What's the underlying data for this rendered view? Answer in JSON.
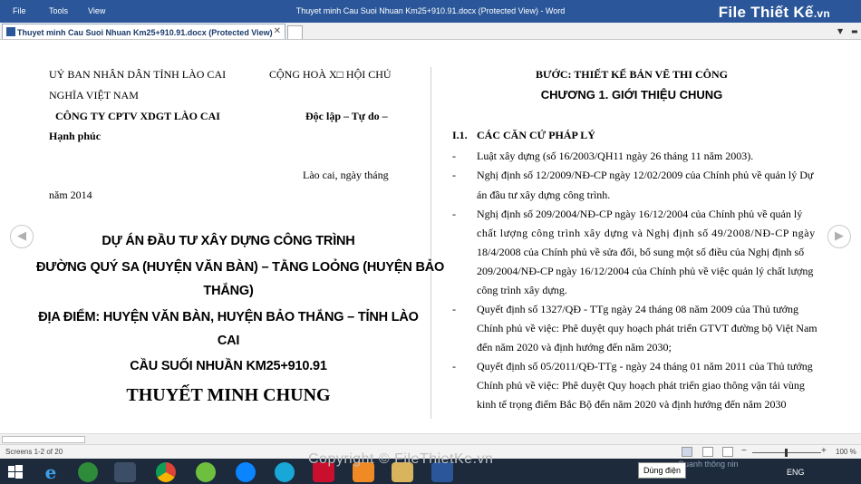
{
  "menu": {
    "file": "File",
    "tools": "Tools",
    "view": "View"
  },
  "window": {
    "title": "Thuyet minh Cau Suoi Nhuan Km25+910.91.docx (Protected View) - Word"
  },
  "brand": {
    "name": "File",
    "name2": "Thiết Kế",
    "suffix": ".vn"
  },
  "tab": {
    "label": "Thuyet minh Cau Suoi Nhuan Km25+910.91.docx (Protected View)",
    "close": "✕"
  },
  "left_page": {
    "gov": "UỶ BAN NHÂN DÂN TỈNH LÀO CAI",
    "republic": "CỘNG HOÀ X□ HỘI CHỦ",
    "vietnam": "NGHĨA VIỆT NAM",
    "company": "CÔNG TY CPTV XDGT LÀO CAI",
    "independence": "Độc lập – Tự do –",
    "happiness": "Hạnh phúc",
    "place_date": "Lào cai, ngày   tháng",
    "year": "năm 2014",
    "project_1": "DỰ ÁN ĐẦU TƯ XÂY DỰNG CÔNG TRÌNH",
    "project_2": "ĐƯỜNG QUÝ SA (HUYỆN VĂN BÀN) – TẰNG LOỎNG (HUYỆN BẢO",
    "project_3": "THẮNG)",
    "location_1": "ĐỊA ĐIỂM: HUYỆN VĂN BÀN, HUYỆN BẢO THẮNG – TỈNH LÀO",
    "location_2": "CAI",
    "bridge": "CẦU SUỐI NHUẦN KM25+910.91",
    "doc_title": "THUYẾT MINH CHUNG"
  },
  "right_page": {
    "step": "BƯỚC: THIẾT KẾ BẢN VẼ THI CÔNG",
    "chapter": "CHƯƠNG 1. GIỚI THIỆU CHUNG",
    "section_no": "I.1.",
    "section_title": "CÁC CĂN CỨ PHÁP LÝ",
    "bullet": "-",
    "lines": [
      "Luật xây dựng (số 16/2003/QH11 ngày 26 tháng 11 năm 2003).",
      "Nghị định số 12/2009/NĐ-CP ngày 12/02/2009 của Chính phủ về quản lý Dự",
      "án đầu tư xây dựng công trình.",
      "Nghị định số 209/2004/NĐ-CP ngày 16/12/2004 của Chính phủ về quản lý",
      "chất lượng công trình xây dựng và Nghị định số 49/2008/NĐ-CP ngày",
      "18/4/2008 của Chính phủ về sửa đổi, bổ sung một số điều của Nghị định số",
      "209/2004/NĐ-CP ngày 16/12/2004 của Chính phủ về việc quản lý chất lượng",
      "công trình xây dựng.",
      "Quyết định số 1327/QĐ - TTg ngày 24 tháng 08 năm 2009 của Thủ tướng",
      "Chính phủ về việc: Phê duyệt quy hoạch phát triển GTVT đường bộ Việt Nam",
      "đến năm 2020 và định hướng đến năm 2030;",
      "Quyết định số 05/2011/QĐ-TTg - ngày 24 tháng 01 năm 2011 của Thủ tướng",
      "Chính phủ về việc: Phê duyệt Quy hoạch phát triển giao thông vận tải vùng",
      "kinh tế trọng điểm Bắc Bộ đến năm 2020 và định hướng đến năm 2030"
    ]
  },
  "status": {
    "screens": "Screens 1-2 of 20",
    "zoom": "100 %",
    "zoom_minus": "−",
    "zoom_plus": "+"
  },
  "watermark": "Copyright © FileThietKe.vn",
  "taskbar": {
    "tooltip": "Dùng điện",
    "lang": "ENG",
    "notice": "Quanh thông nin"
  },
  "colors": {
    "word_blue": "#2b579a",
    "taskbar": "#1c2a3c"
  }
}
